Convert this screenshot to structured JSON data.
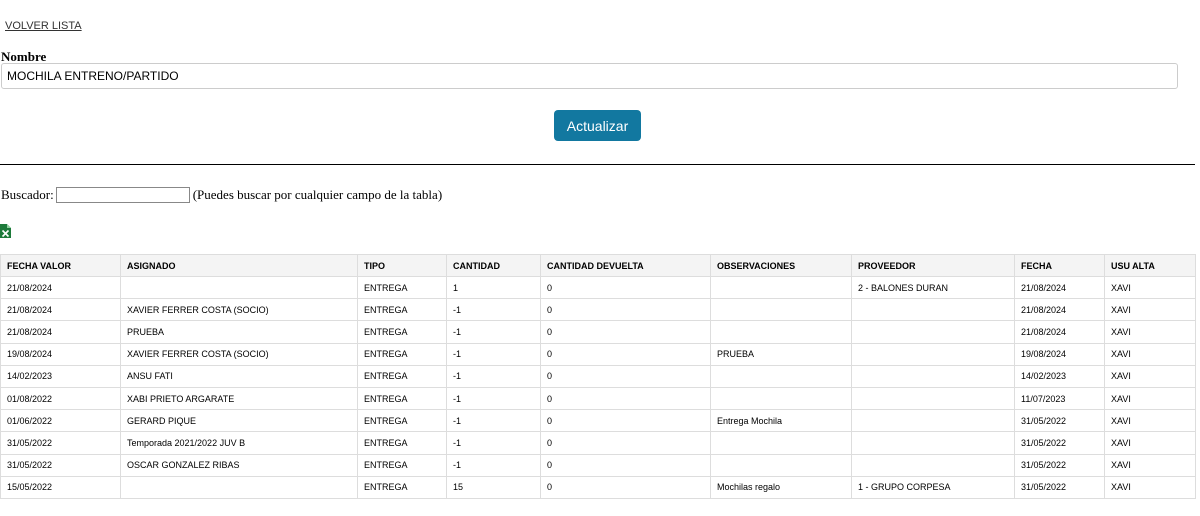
{
  "nav": {
    "back_label": "VOLVER LISTA"
  },
  "form": {
    "name_label": "Nombre",
    "name_value": "MOCHILA ENTRENO/PARTIDO",
    "update_label": "Actualizar"
  },
  "search": {
    "label": "Buscador:",
    "value": "",
    "hint": "(Puedes buscar por cualquier campo de la tabla)"
  },
  "icons": {
    "export": "excel-icon"
  },
  "colors": {
    "button": "#1278a0",
    "excel": "#1d7a3a"
  },
  "table": {
    "columns": [
      "FECHA VALOR",
      "ASIGNADO",
      "TIPO",
      "CANTIDAD",
      "CANTIDAD DEVUELTA",
      "OBSERVACIONES",
      "PROVEEDOR",
      "FECHA",
      "USU ALTA"
    ],
    "rows": [
      [
        "21/08/2024",
        "",
        "ENTREGA",
        "1",
        "0",
        "",
        "2 - BALONES DURAN",
        "21/08/2024",
        "XAVI"
      ],
      [
        "21/08/2024",
        "XAVIER FERRER COSTA (SOCIO)",
        "ENTREGA",
        "-1",
        "0",
        "",
        "",
        "21/08/2024",
        "XAVI"
      ],
      [
        "21/08/2024",
        "PRUEBA",
        "ENTREGA",
        "-1",
        "0",
        "",
        "",
        "21/08/2024",
        "XAVI"
      ],
      [
        "19/08/2024",
        "XAVIER FERRER COSTA (SOCIO)",
        "ENTREGA",
        "-1",
        "0",
        "PRUEBA",
        "",
        "19/08/2024",
        "XAVI"
      ],
      [
        "14/02/2023",
        "ANSU FATI",
        "ENTREGA",
        "-1",
        "0",
        "",
        "",
        "14/02/2023",
        "XAVI"
      ],
      [
        "01/08/2022",
        "XABI PRIETO ARGARATE",
        "ENTREGA",
        "-1",
        "0",
        "",
        "",
        "11/07/2023",
        "XAVI"
      ],
      [
        "01/06/2022",
        "GERARD PIQUE",
        "ENTREGA",
        "-1",
        "0",
        "Entrega Mochila",
        "",
        "31/05/2022",
        "XAVI"
      ],
      [
        "31/05/2022",
        "Temporada 2021/2022 JUV B",
        "ENTREGA",
        "-1",
        "0",
        "",
        "",
        "31/05/2022",
        "XAVI"
      ],
      [
        "31/05/2022",
        "OSCAR GONZALEZ RIBAS",
        "ENTREGA",
        "-1",
        "0",
        "",
        "",
        "31/05/2022",
        "XAVI"
      ],
      [
        "15/05/2022",
        "",
        "ENTREGA",
        "15",
        "0",
        "Mochilas regalo",
        "1 - GRUPO CORPESA",
        "31/05/2022",
        "XAVI"
      ]
    ]
  }
}
